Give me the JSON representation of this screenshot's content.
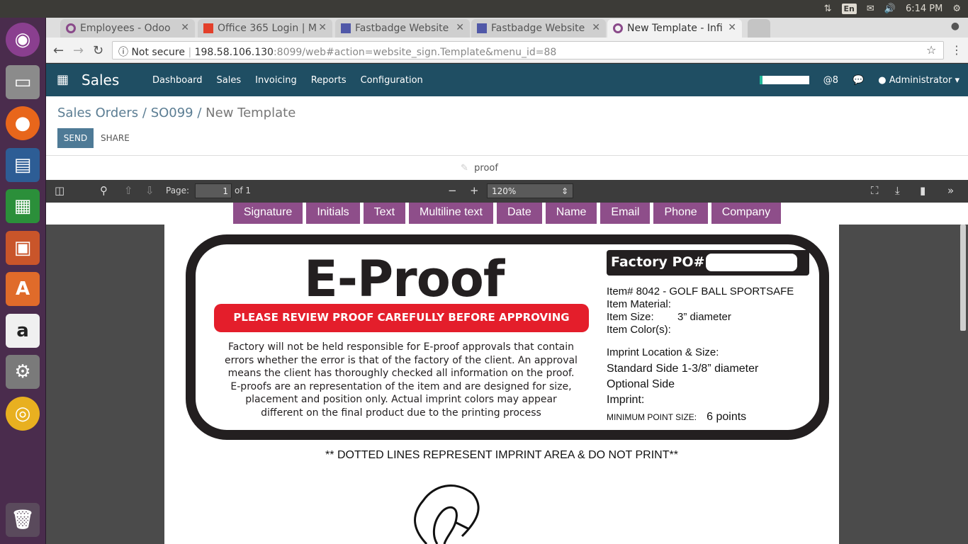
{
  "system_bar": {
    "lang": "En",
    "time": "6:14 PM"
  },
  "browser": {
    "tabs": [
      {
        "title": "Employees - Odoo",
        "active": false
      },
      {
        "title": "Office 365 Login | M",
        "active": false
      },
      {
        "title": "Fastbadge Website",
        "active": false
      },
      {
        "title": "Fastbadge Website",
        "active": false
      },
      {
        "title": "New Template - Infi",
        "active": true
      }
    ],
    "security": "Not secure",
    "url_host": "198.58.106.130",
    "url_rest": ":8099/web#action=website_sign.Template&menu_id=88"
  },
  "odoo": {
    "app_name": "Sales",
    "menu": [
      "Dashboard",
      "Sales",
      "Invoicing",
      "Reports",
      "Configuration"
    ],
    "mentions": "@8",
    "user": "Administrator"
  },
  "breadcrumb": {
    "items": [
      "Sales Orders",
      "SO099"
    ],
    "current": "New Template"
  },
  "actions": {
    "send": "SEND",
    "share": "SHARE"
  },
  "template_name": "proof",
  "pdf_toolbar": {
    "page_label": "Page:",
    "page": "1",
    "of_label": "of 1",
    "zoom": "120%"
  },
  "field_types": [
    "Signature",
    "Initials",
    "Text",
    "Multiline text",
    "Date",
    "Name",
    "Email",
    "Phone",
    "Company"
  ],
  "document": {
    "heading": "E-Proof",
    "banner": "PLEASE REVIEW PROOF CAREFULLY BEFORE APPROVING",
    "disclaimer": "Factory will not be held responsible for E-proof approvals that contain errors whether the error is that of the factory of the client.  An approval means the client has thoroughly checked all information on the proof.  E-proofs are an representation of the item and are designed for size, placement and position only.  Actual imprint colors may appear different on the final product due to the printing process",
    "po_label": "Factory PO#:",
    "item": "Item#   8042 - GOLF BALL SPORTSAFE",
    "material": "Item Material:",
    "size": "Item Size:        3” diameter",
    "color": "Item Color(s):",
    "imprint_loc": "Imprint Location & Size:",
    "standard": "Standard Side  1-3/8” diameter",
    "optional": "Optional Side",
    "imprint": "Imprint:",
    "min_label": "MINIMUM POINT SIZE:",
    "min_value": "6 points",
    "footer_note": "** DOTTED LINES REPRESENT IMPRINT AREA & DO NOT PRINT**"
  },
  "colors": {
    "odoo_nav": "#1f4e63",
    "field_button": "#8e4e8a",
    "banner": "#e41e2b",
    "launcher": "#4a2c4d"
  }
}
